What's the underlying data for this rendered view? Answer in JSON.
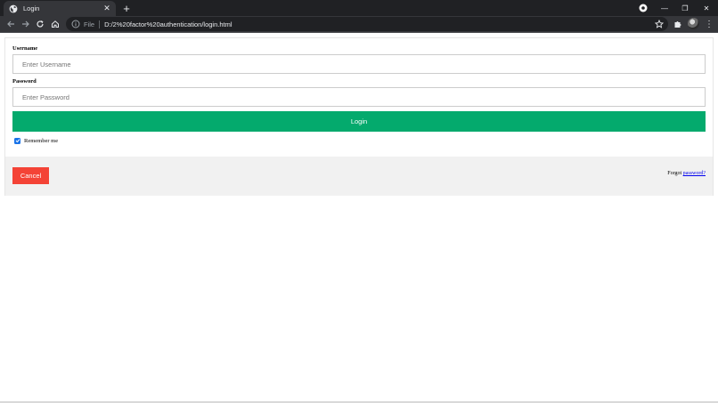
{
  "browser": {
    "tab_title": "Login",
    "new_tab_label": "+",
    "close_tab_label": "✕",
    "address": {
      "scheme_label": "File",
      "url": "D:/2%20factor%20authentication/login.html"
    },
    "window_controls": {
      "minimize": "—",
      "restore": "❐",
      "close": "✕"
    },
    "menu_label": "⋮"
  },
  "form": {
    "username_label": "Username",
    "username_placeholder": "Enter Username",
    "username_value": "",
    "password_label": "Password",
    "password_placeholder": "Enter Password",
    "password_value": "",
    "login_button": "Login",
    "remember_label": "Remember me",
    "remember_checked": true
  },
  "footer": {
    "cancel_button": "Cancel",
    "forgot_prefix": "Forgot ",
    "forgot_link": "password?"
  },
  "colors": {
    "login_green": "#04aa6d",
    "cancel_red": "#f44336",
    "footer_bg": "#f1f1f1",
    "link_blue": "#0000ee"
  }
}
